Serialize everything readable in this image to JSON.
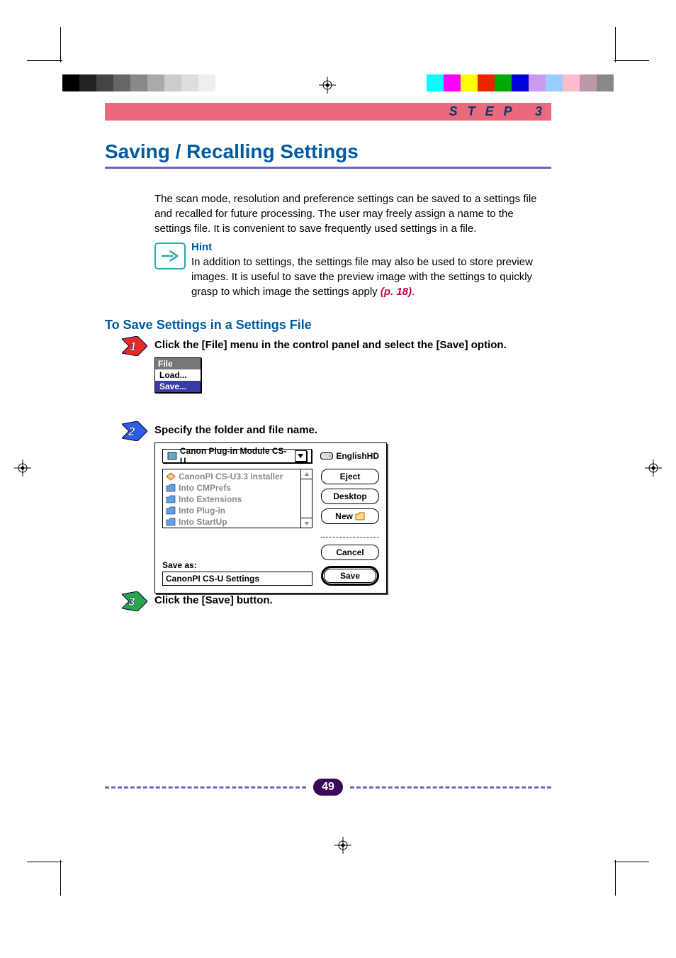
{
  "header": {
    "step_label": "STEP 3"
  },
  "title": "Saving / Recalling Settings",
  "intro": "The scan mode, resolution and preference settings can be saved to a settings file and recalled for future processing. The user may freely assign a name to the settings file. It is convenient to save frequently used settings in a file.",
  "hint": {
    "title": "Hint",
    "body": "In addition to settings, the settings file may also be used to store preview images. It is useful to save the preview image with the settings to quickly grasp to which image the settings apply ",
    "ref": "(p. 18)",
    "period": "."
  },
  "section_title": "To Save Settings in a Settings File",
  "steps": {
    "s1": "Click the [File] menu in the control panel and select the [Save] option.",
    "s2": "Specify the folder and file name.",
    "s3": "Click the [Save] button."
  },
  "file_menu": {
    "header": "File",
    "load": "Load...",
    "save": "Save..."
  },
  "dialog": {
    "popup": "Canon Plug-in Module CS-U",
    "disk": "EnglishHD",
    "list": [
      "CanonPI CS-U3.3 installer",
      "Into CMPrefs",
      "Into Extensions",
      "Into Plug-in",
      "Into StartUp"
    ],
    "eject": "Eject",
    "desktop": "Desktop",
    "new": "New",
    "cancel": "Cancel",
    "save": "Save",
    "save_as_label": "Save as:",
    "save_as_value": "CanonPI CS-U Settings"
  },
  "page_number": "49"
}
